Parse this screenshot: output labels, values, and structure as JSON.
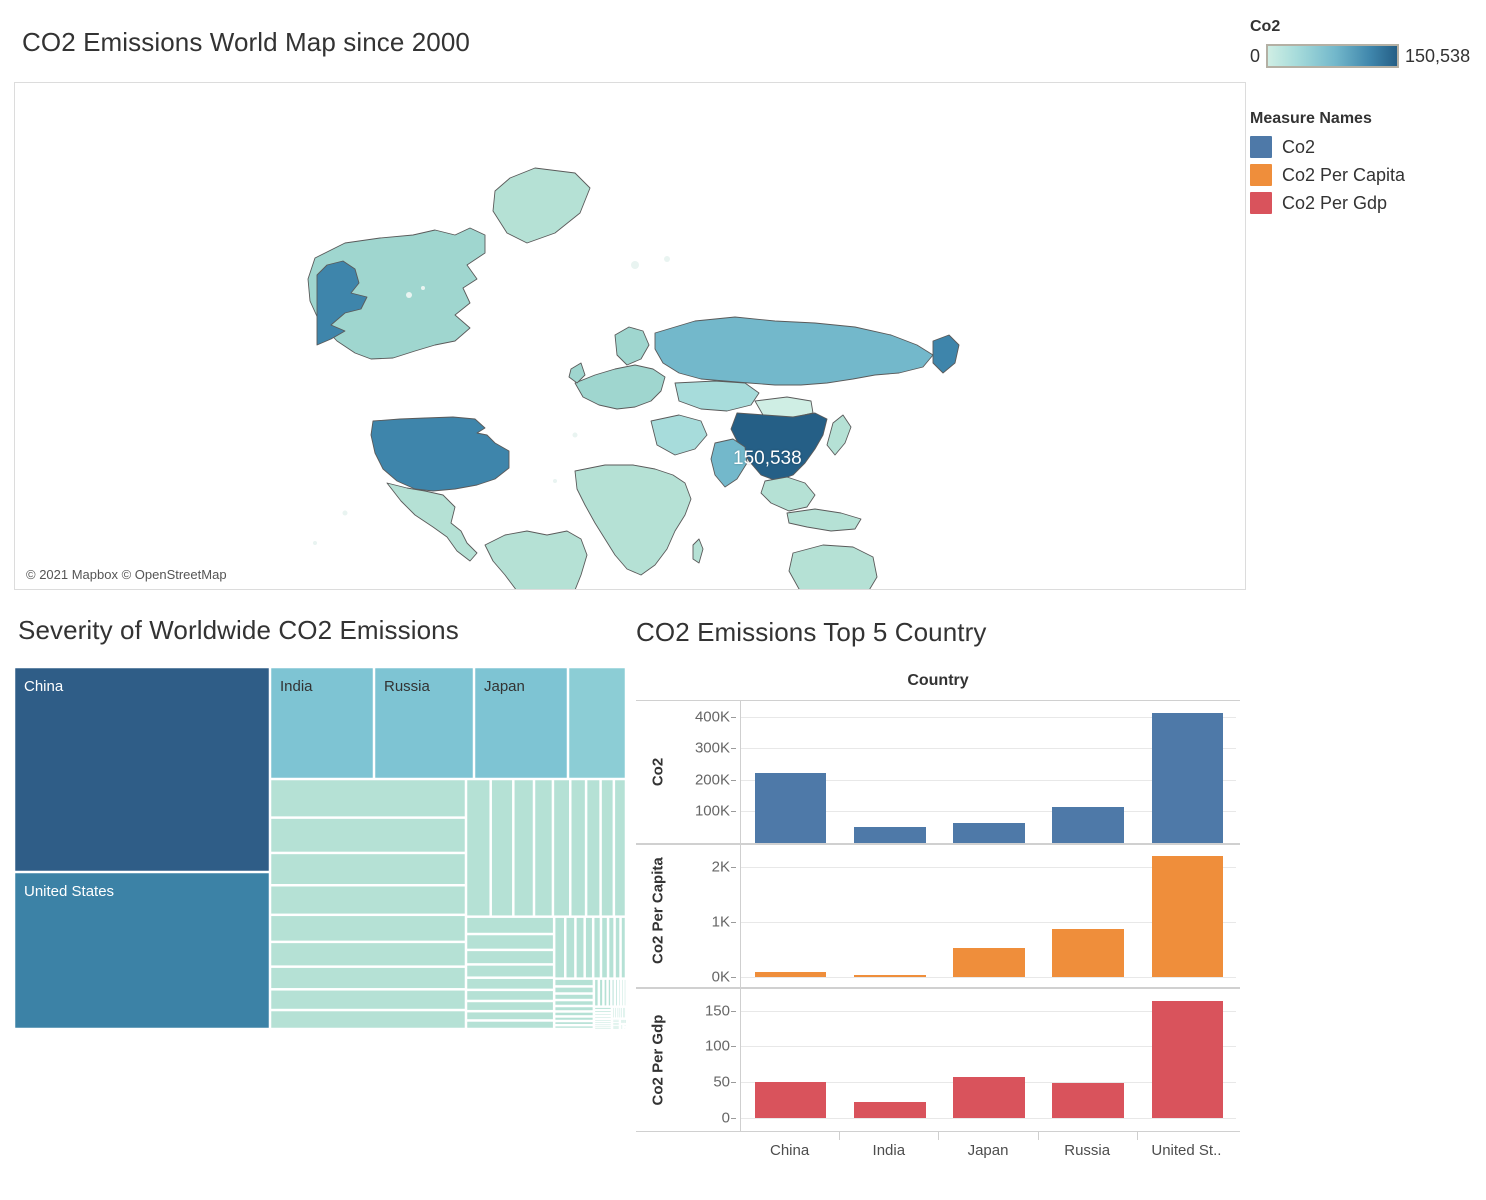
{
  "dashboard": {
    "map_title": "CO2 Emissions World Map since 2000",
    "treemap_title": "Severity of Worldwide CO2 Emissions",
    "barchart_title": "CO2 Emissions Top 5 Country"
  },
  "map": {
    "attribution": "© 2021 Mapbox  © OpenStreetMap",
    "highlight_label": "150,538",
    "highlight_country": "China"
  },
  "legend": {
    "gradient": {
      "title": "Co2",
      "min": "0",
      "max": "150,538",
      "color_low": "#cfeee4",
      "color_high": "#255f86"
    },
    "measure_names": {
      "title": "Measure Names",
      "items": [
        {
          "label": "Co2",
          "color": "#4e79a8"
        },
        {
          "label": "Co2 Per Capita",
          "color": "#ef8e3b"
        },
        {
          "label": "Co2 Per Gdp",
          "color": "#d9535c"
        }
      ]
    }
  },
  "chart_data": [
    {
      "type": "treemap",
      "title": "Severity of Worldwide CO2 Emissions",
      "colorbar": {
        "label": "Co2",
        "min": 0,
        "max": 150538
      },
      "labeled_tiles": [
        {
          "label": "China",
          "value": 150538,
          "color": "#2f5d87"
        },
        {
          "label": "United States",
          "value": 128000,
          "color": "#3c82a6"
        },
        {
          "label": "India",
          "value": 36000,
          "color": "#7ec4d3"
        },
        {
          "label": "Russia",
          "value": 32000,
          "color": "#7ec4d3"
        },
        {
          "label": "Japan",
          "value": 28000,
          "color": "#7ec4d3"
        }
      ],
      "unlabeled_tile_count": 96,
      "unlabeled_tile_color": "#b5e1d5",
      "note": "Remaining countries shown as progressively smaller unlabeled tiles"
    },
    {
      "type": "bar",
      "title": "CO2 Emissions Top 5 Country",
      "column_header": "Country",
      "xlabel": "",
      "categories": [
        "China",
        "India",
        "Japan",
        "Russia",
        "United St.."
      ],
      "panels": [
        {
          "ylabel": "Co2",
          "color": "#4e79a8",
          "ticks": [
            "100K",
            "200K",
            "300K",
            "400K"
          ],
          "tick_values": [
            100000,
            200000,
            300000,
            400000
          ],
          "ylim": [
            0,
            450000
          ],
          "values": [
            223000,
            51000,
            64000,
            114000,
            413000
          ]
        },
        {
          "ylabel": "Co2 Per Capita",
          "color": "#ef8e3b",
          "ticks": [
            "0K",
            "1K",
            "2K"
          ],
          "tick_values": [
            0,
            1000,
            2000
          ],
          "ylim": [
            -180,
            2400
          ],
          "values": [
            90,
            30,
            520,
            870,
            2200
          ]
        },
        {
          "ylabel": "Co2 Per Gdp",
          "color": "#d9535c",
          "ticks": [
            "0",
            "50",
            "100",
            "150"
          ],
          "tick_values": [
            0,
            50,
            100,
            150
          ],
          "ylim": [
            -18,
            180
          ],
          "values": [
            51,
            22,
            57,
            49,
            163
          ]
        }
      ]
    }
  ]
}
